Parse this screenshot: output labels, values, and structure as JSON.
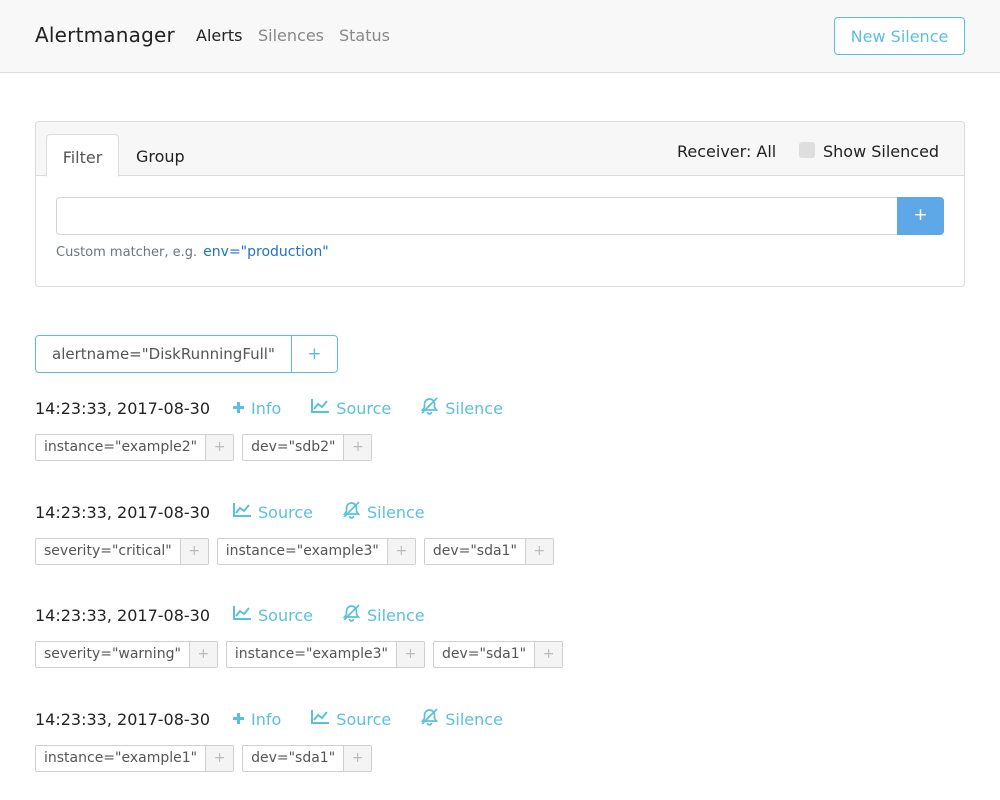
{
  "nav": {
    "brand": "Alertmanager",
    "links": [
      "Alerts",
      "Silences",
      "Status"
    ],
    "new_silence": "New Silence"
  },
  "filter": {
    "tabs": [
      "Filter",
      "Group"
    ],
    "receiver": "Receiver: All",
    "show_silenced": "Show Silenced",
    "input_value": "",
    "add": "+",
    "hint": "Custom matcher, e.g.",
    "hint_example": "env=\"production\""
  },
  "group": {
    "label": "alertname=\"DiskRunningFull\"",
    "add": "+"
  },
  "alerts": [
    {
      "time": "14:23:33, 2017-08-30",
      "info": "Info",
      "source": "Source",
      "silence": "Silence",
      "labels": [
        "instance=\"example2\"",
        "dev=\"sdb2\""
      ]
    },
    {
      "time": "14:23:33, 2017-08-30",
      "source": "Source",
      "silence": "Silence",
      "labels": [
        "severity=\"critical\"",
        "instance=\"example3\"",
        "dev=\"sda1\""
      ]
    },
    {
      "time": "14:23:33, 2017-08-30",
      "source": "Source",
      "silence": "Silence",
      "labels": [
        "severity=\"warning\"",
        "instance=\"example3\"",
        "dev=\"sda1\""
      ]
    },
    {
      "time": "14:23:33, 2017-08-30",
      "info": "Info",
      "source": "Source",
      "silence": "Silence",
      "labels": [
        "instance=\"example1\"",
        "dev=\"sda1\""
      ]
    }
  ],
  "chip_add": "+",
  "colors": {
    "accent": "#5bc0de",
    "primary": "#5fa8e8",
    "link": "#1a73c8"
  },
  "icons": [
    "plus-icon",
    "chart-line-icon",
    "bell-slash-icon"
  ]
}
